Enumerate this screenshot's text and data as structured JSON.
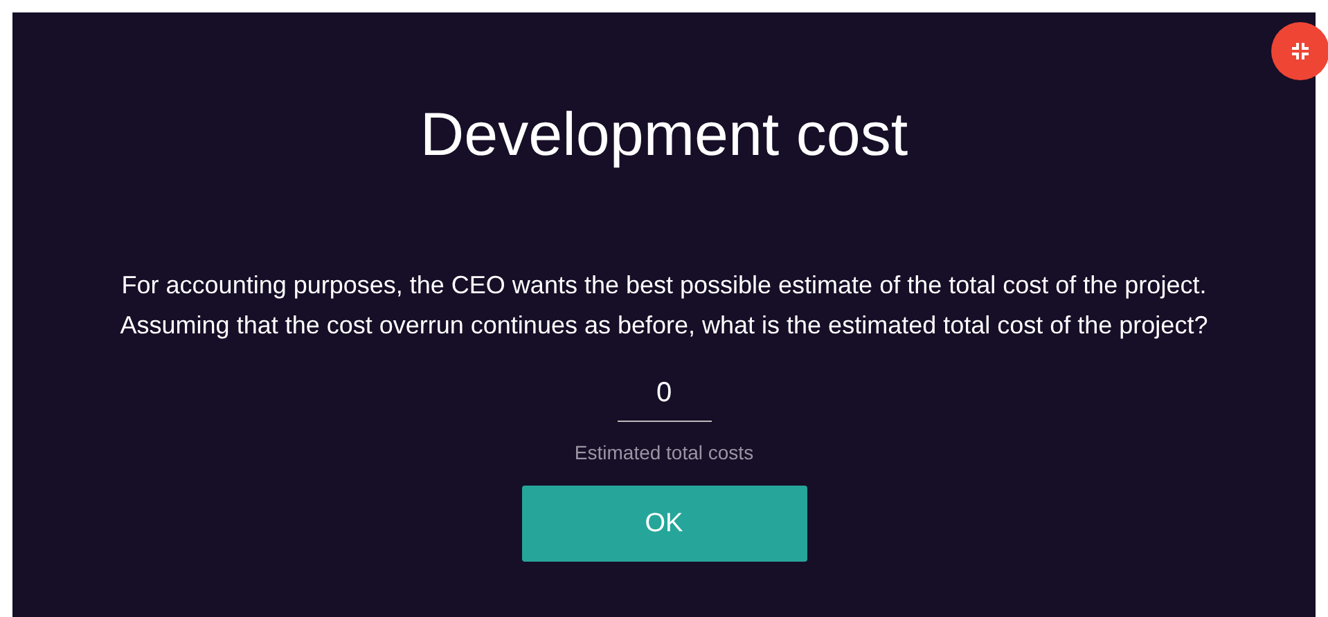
{
  "title": "Development cost",
  "question": [
    "For accounting purposes, the CEO wants the best possible estimate of the total cost of the project.",
    "Assuming that the cost overrun continues as before, what is the estimated total cost of the project?"
  ],
  "answer": {
    "value": "0",
    "label": "Estimated total costs"
  },
  "buttons": [
    "OK"
  ]
}
